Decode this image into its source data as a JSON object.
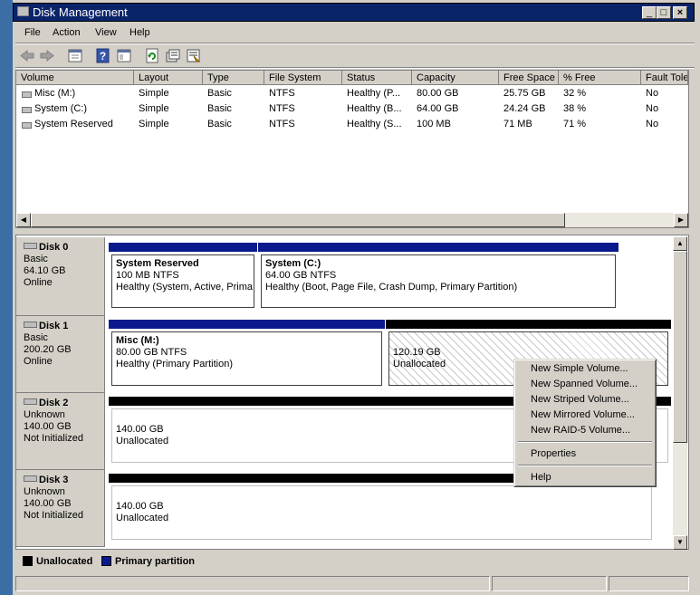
{
  "window": {
    "title": "Disk Management"
  },
  "menu": [
    "File",
    "Action",
    "View",
    "Help"
  ],
  "toolbar": [
    "back-icon",
    "forward-icon",
    "properties-icon",
    "help-icon",
    "show-hide-icon",
    "refresh-icon",
    "rescan-icon",
    "settings-icon"
  ],
  "volume_list": {
    "columns": [
      "Volume",
      "Layout",
      "Type",
      "File System",
      "Status",
      "Capacity",
      "Free Space",
      "% Free",
      "Fault Tole"
    ],
    "rows": [
      [
        "Misc (M:)",
        "Simple",
        "Basic",
        "NTFS",
        "Healthy (P...",
        "80.00 GB",
        "25.75 GB",
        "32 %",
        "No"
      ],
      [
        "System (C:)",
        "Simple",
        "Basic",
        "NTFS",
        "Healthy (B...",
        "64.00 GB",
        "24.24 GB",
        "38 %",
        "No"
      ],
      [
        "System Reserved",
        "Simple",
        "Basic",
        "NTFS",
        "Healthy (S...",
        "100 MB",
        "71 MB",
        "71 %",
        "No"
      ]
    ]
  },
  "disks": [
    {
      "name": "Disk 0",
      "type": "Basic",
      "size": "64.10 GB",
      "status": "Online",
      "partitions": [
        {
          "title": "System Reserved",
          "size_fs": "100 MB NTFS",
          "status": "Healthy (System, Active, Prima"
        },
        {
          "title": "System  (C:)",
          "size_fs": "64.00 GB NTFS",
          "status": "Healthy (Boot, Page File, Crash Dump, Primary Partition)"
        }
      ]
    },
    {
      "name": "Disk 1",
      "type": "Basic",
      "size": "200.20 GB",
      "status": "Online",
      "partitions": [
        {
          "title": "Misc  (M:)",
          "size_fs": "80.00 GB NTFS",
          "status": "Healthy (Primary Partition)"
        },
        {
          "size_fs": "120.19 GB",
          "status": "Unallocated"
        }
      ]
    },
    {
      "name": "Disk 2",
      "type": "Unknown",
      "size": "140.00 GB",
      "status": "Not Initialized",
      "partitions": [
        {
          "size_fs": "140.00 GB",
          "status": "Unallocated"
        }
      ]
    },
    {
      "name": "Disk 3",
      "type": "Unknown",
      "size": "140.00 GB",
      "status": "Not Initialized",
      "partitions": [
        {
          "size_fs": "140.00 GB",
          "status": "Unallocated"
        }
      ]
    }
  ],
  "legend": [
    {
      "label": "Unallocated",
      "color": "#000000"
    },
    {
      "label": "Primary partition",
      "color": "#0a1a8c"
    }
  ],
  "context_menu": {
    "items": [
      "New Simple Volume...",
      "New Spanned Volume...",
      "New Striped Volume...",
      "New Mirrored Volume...",
      "New RAID-5 Volume..."
    ],
    "properties": "Properties",
    "help": "Help"
  },
  "colors": {
    "primary_bar": "#0a1a8c",
    "unallocated_bar": "#000000",
    "titlebar": "#0a246a",
    "desktop": "#3a6ea5"
  }
}
